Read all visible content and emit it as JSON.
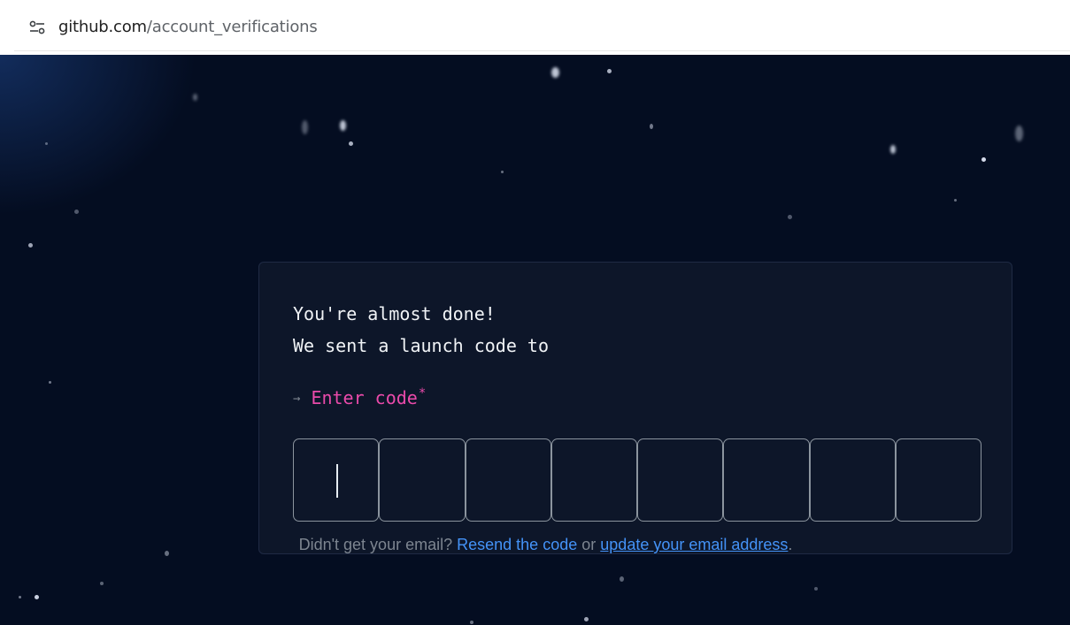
{
  "browser": {
    "url_domain": "github.com",
    "url_path": "/account_verifications",
    "site_info_icon": "tune-icon"
  },
  "verification": {
    "heading_line1": "You're almost done!",
    "heading_line2": "We sent a launch code to",
    "enter_arrow": "→",
    "enter_label": "Enter code",
    "required_mark": "*",
    "code_digit_count": 8,
    "code_values": [
      "",
      "",
      "",
      "",
      "",
      "",
      "",
      ""
    ]
  },
  "footer": {
    "prefix": "Didn't get your email?",
    "resend_link": "Resend the code",
    "connector": "or",
    "update_link": "update your email address",
    "suffix": "."
  },
  "colors": {
    "background": "#040d21",
    "card": "#0d1629",
    "accent_pink": "#ea4aaa",
    "link_blue": "#4493f8",
    "muted_text": "#7d8590"
  }
}
